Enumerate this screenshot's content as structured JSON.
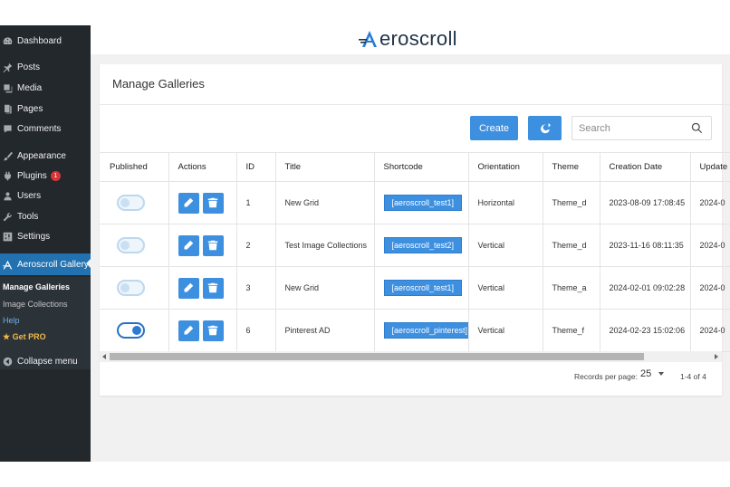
{
  "sidebar": {
    "items": [
      {
        "label": "Dashboard",
        "icon": "dashboard-icon"
      },
      {
        "label": "Posts",
        "icon": "pin-icon"
      },
      {
        "label": "Media",
        "icon": "media-icon"
      },
      {
        "label": "Pages",
        "icon": "pages-icon"
      },
      {
        "label": "Comments",
        "icon": "comment-icon"
      },
      {
        "label": "Appearance",
        "icon": "brush-icon"
      },
      {
        "label": "Plugins",
        "icon": "plug-icon",
        "badge": "1"
      },
      {
        "label": "Users",
        "icon": "user-icon"
      },
      {
        "label": "Tools",
        "icon": "wrench-icon"
      },
      {
        "label": "Settings",
        "icon": "settings-icon"
      },
      {
        "label": "Aeroscroll Gallery",
        "icon": "aeroscroll-icon"
      }
    ],
    "submenu": {
      "manage": "Manage Galleries",
      "collections": "Image Collections",
      "help": "Help",
      "pro": "Get PRO"
    },
    "collapse": "Collapse menu"
  },
  "header": {
    "logo_text": "Aeroscroll"
  },
  "page": {
    "title": "Manage Galleries",
    "create_label": "Create",
    "search_placeholder": "Search"
  },
  "table": {
    "columns": [
      "Published",
      "Actions",
      "ID",
      "Title",
      "Shortcode",
      "Orientation",
      "Theme",
      "Creation Date",
      "Update"
    ],
    "rows": [
      {
        "published": false,
        "id": "1",
        "title": "New Grid",
        "shortcode": "[aeroscroll_test1]",
        "orientation": "Horizontal",
        "theme": "Theme_d",
        "created": "2023-08-09 17:08:45",
        "updated": "2024-0"
      },
      {
        "published": false,
        "id": "2",
        "title": "Test Image Collections",
        "shortcode": "[aeroscroll_test2]",
        "orientation": "Vertical",
        "theme": "Theme_d",
        "created": "2023-11-16 08:11:35",
        "updated": "2024-0"
      },
      {
        "published": false,
        "id": "3",
        "title": "New Grid",
        "shortcode": "[aeroscroll_test1]",
        "orientation": "Vertical",
        "theme": "Theme_a",
        "created": "2024-02-01 09:02:28",
        "updated": "2024-0"
      },
      {
        "published": true,
        "id": "6",
        "title": "Pinterest AD",
        "shortcode": "[aeroscroll_pinterest]",
        "orientation": "Vertical",
        "theme": "Theme_f",
        "created": "2024-02-23 15:02:06",
        "updated": "2024-0"
      }
    ]
  },
  "pagination": {
    "label": "Records per page:",
    "per_page": "25",
    "range": "1-4 of 4"
  },
  "colors": {
    "accent": "#3d8fe0",
    "sidebar": "#23282d",
    "active": "#2271b1"
  }
}
